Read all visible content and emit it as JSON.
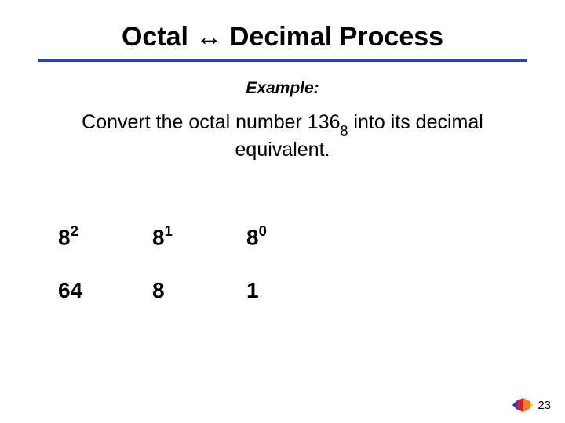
{
  "title": "Octal ↔ Decimal Process",
  "example_label": "Example:",
  "prompt_pre": "Convert the octal number 136",
  "prompt_sub": "8",
  "prompt_post": " into its decimal equivalent.",
  "powers": {
    "base": "8",
    "exps": [
      "2",
      "1",
      "0"
    ],
    "values": [
      "64",
      "8",
      "1"
    ]
  },
  "page_number": "23",
  "logo_name": "pltw-logo"
}
